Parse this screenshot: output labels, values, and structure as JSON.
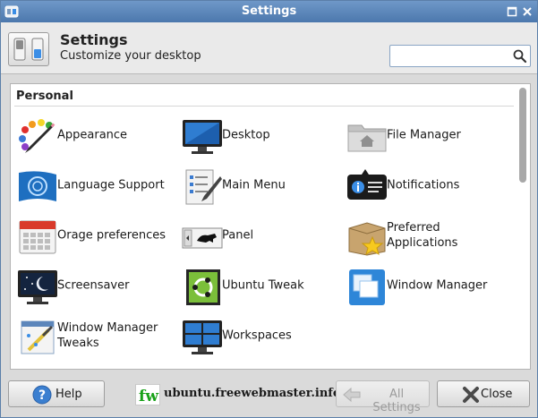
{
  "window": {
    "title": "Settings",
    "controls": {
      "maximize_icon": "maximize-icon",
      "close_icon": "close-icon"
    }
  },
  "header": {
    "title": "Settings",
    "subtitle": "Customize your desktop",
    "icon": "settings-toggle-icon"
  },
  "search": {
    "value": "",
    "placeholder": "",
    "icon": "search-icon"
  },
  "sections": [
    {
      "title": "Personal",
      "items": [
        {
          "label": "Appearance",
          "icon": "palette-icon"
        },
        {
          "label": "Desktop",
          "icon": "monitor-icon"
        },
        {
          "label": "File Manager",
          "icon": "folder-home-icon"
        },
        {
          "label": "Language Support",
          "icon": "language-flag-icon"
        },
        {
          "label": "Main Menu",
          "icon": "menu-editor-icon"
        },
        {
          "label": "Notifications",
          "icon": "notification-icon"
        },
        {
          "label": "Orage preferences",
          "icon": "calendar-icon"
        },
        {
          "label": "Panel",
          "icon": "panel-icon"
        },
        {
          "label": "Preferred Applications",
          "icon": "preferred-apps-icon"
        },
        {
          "label": "Screensaver",
          "icon": "screensaver-icon"
        },
        {
          "label": "Ubuntu Tweak",
          "icon": "ubuntu-tweak-icon"
        },
        {
          "label": "Window Manager",
          "icon": "window-manager-icon"
        },
        {
          "label": "Window Manager Tweaks",
          "icon": "window-tweaks-icon"
        },
        {
          "label": "Workspaces",
          "icon": "workspaces-icon"
        }
      ]
    }
  ],
  "footer": {
    "help_label": "Help",
    "all_settings_label": "All Settings",
    "close_label": "Close",
    "watermark_logo": "fw",
    "watermark_text": "ubuntu.freewebmaster.info"
  },
  "colors": {
    "titlebar": "#4c78ad",
    "accent": "#3b8ee6",
    "content_bg": "#ffffff"
  }
}
